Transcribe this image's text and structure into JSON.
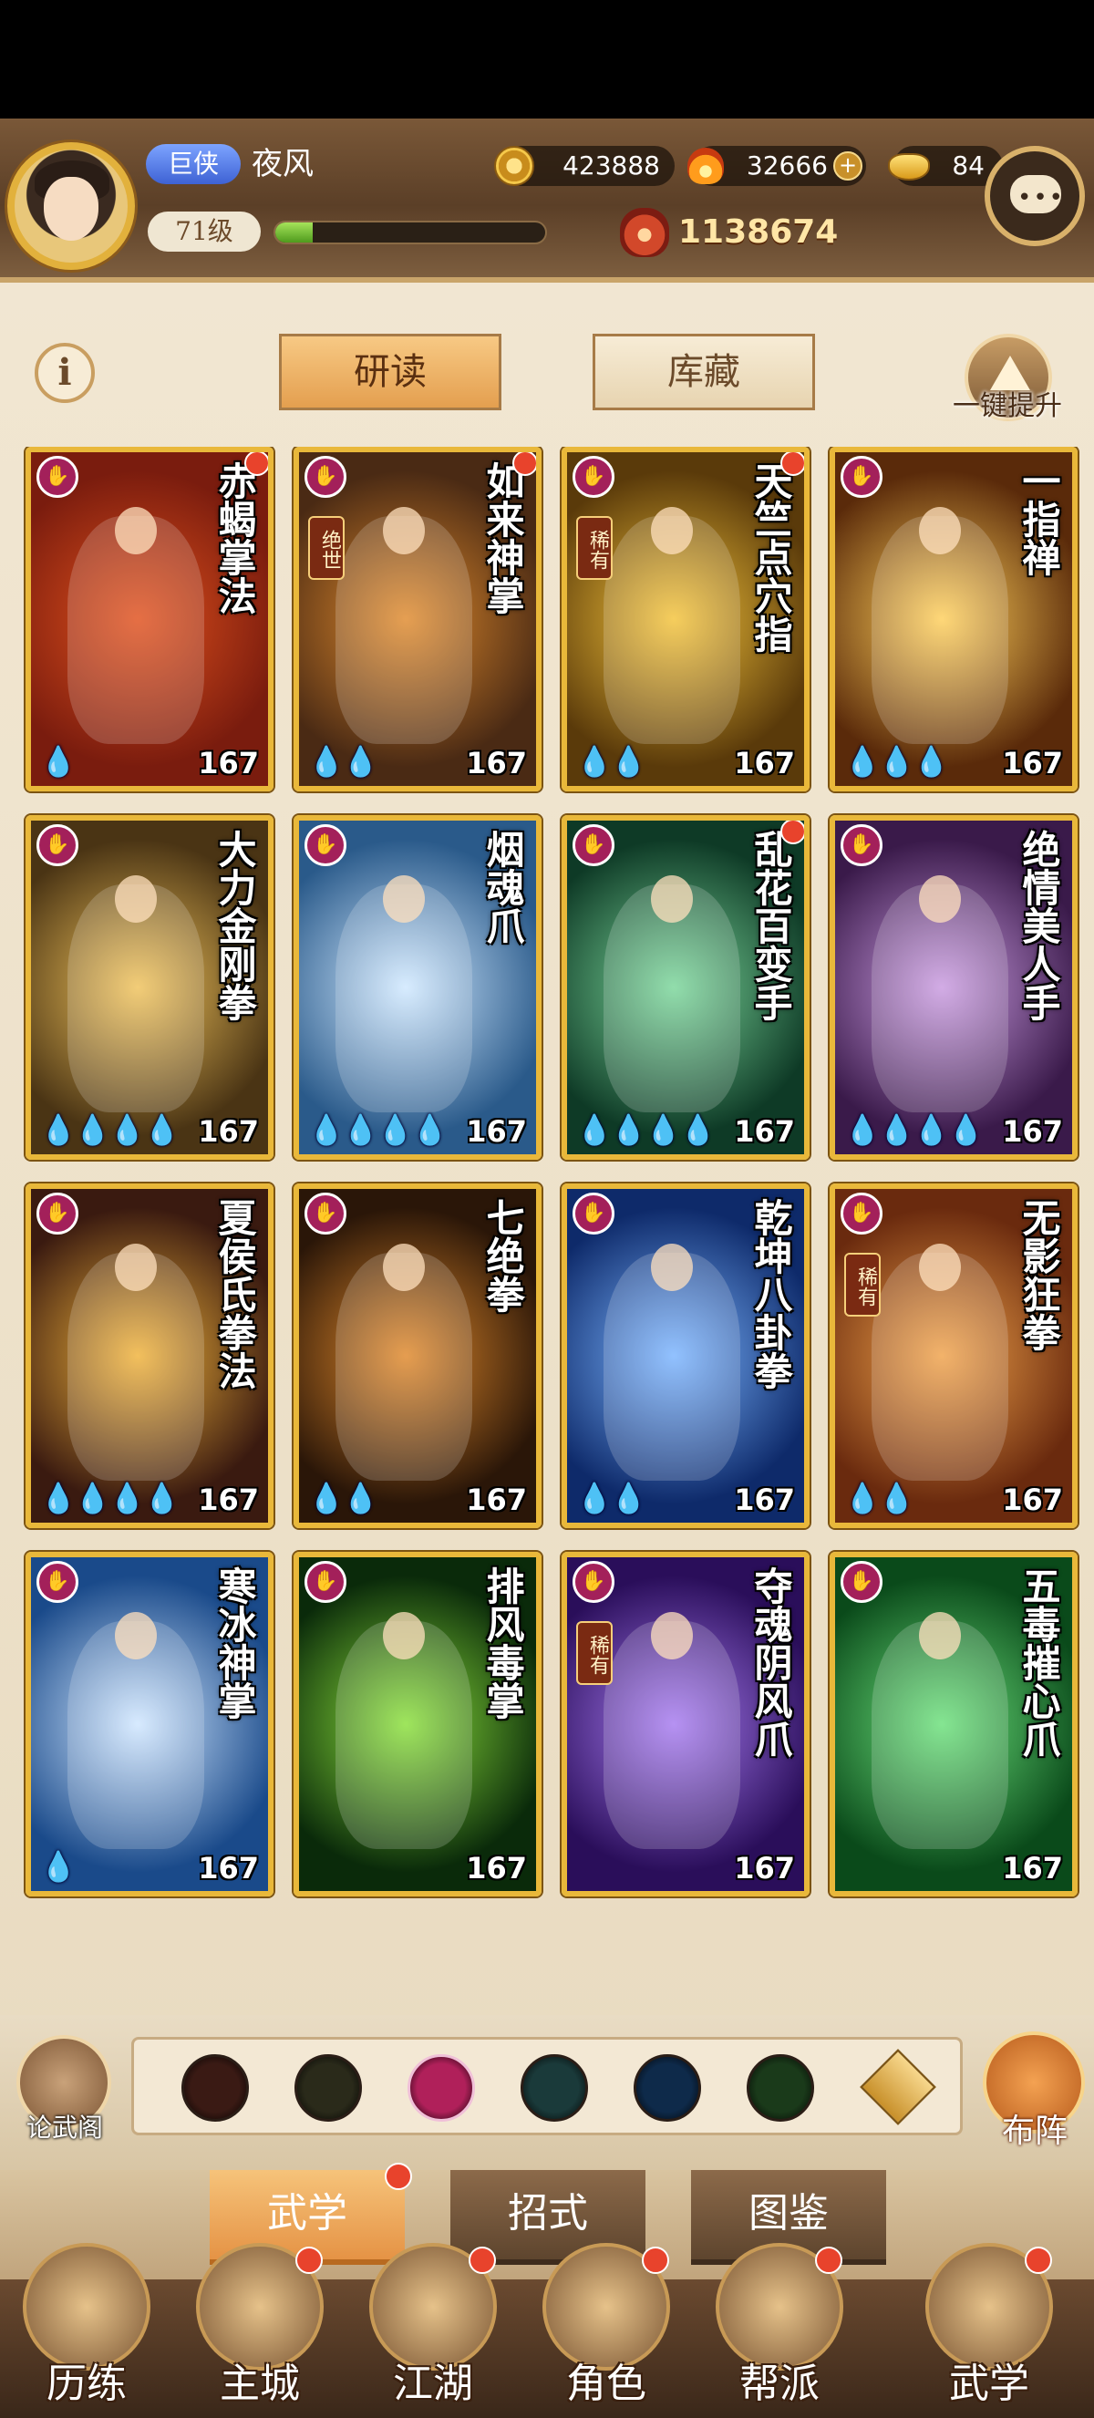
{
  "player": {
    "rank": "巨侠",
    "name": "夜风",
    "level": "71级",
    "exp_fraction": 0.14
  },
  "resources": {
    "coins": "423888",
    "spirit": "32666",
    "gold": "84",
    "plus": "+"
  },
  "power": "1138674",
  "subtabs": {
    "study": "研读",
    "collection": "库藏",
    "upgrade_all": "一键提升"
  },
  "cards": [
    {
      "name": "赤蝎掌法",
      "drops": "💧",
      "level": "167",
      "tag": "",
      "dot": true,
      "bg": "#7a1c0e",
      "bg2": "#e0501c"
    },
    {
      "name": "如来神掌",
      "drops": "💧💧",
      "level": "167",
      "tag": "绝世",
      "dot": true,
      "bg": "#4a2a14",
      "bg2": "#e08a2c"
    },
    {
      "name": "天竺点穴指",
      "drops": "💧💧",
      "level": "167",
      "tag": "稀有",
      "dot": true,
      "bg": "#5a3a0a",
      "bg2": "#f4c33a"
    },
    {
      "name": "一指禅",
      "drops": "💧💧💧",
      "level": "167",
      "tag": "",
      "dot": false,
      "bg": "#5a2a0a",
      "bg2": "#ffcf5a"
    },
    {
      "name": "大力金刚拳",
      "drops": "💧💧💧💧",
      "level": "167",
      "tag": "",
      "dot": false,
      "bg": "#4a3414",
      "bg2": "#f0c25a"
    },
    {
      "name": "烟魂爪",
      "drops": "💧💧💧💧",
      "level": "167",
      "tag": "",
      "dot": false,
      "bg": "#2a5a8a",
      "bg2": "#cfe8ff"
    },
    {
      "name": "乱花百变手",
      "drops": "💧💧💧💧",
      "level": "167",
      "tag": "",
      "dot": true,
      "bg": "#0e3a26",
      "bg2": "#7ad69a"
    },
    {
      "name": "绝情美人手",
      "drops": "💧💧💧💧",
      "level": "167",
      "tag": "",
      "dot": false,
      "bg": "#3a1a4a",
      "bg2": "#c99ae0"
    },
    {
      "name": "夏侯氏拳法",
      "drops": "💧💧💧💧",
      "level": "167",
      "tag": "",
      "dot": false,
      "bg": "#3a1a10",
      "bg2": "#f0b23a"
    },
    {
      "name": "七绝拳",
      "drops": "💧💧",
      "level": "167",
      "tag": "",
      "dot": false,
      "bg": "#2a1608",
      "bg2": "#e0882a"
    },
    {
      "name": "乾坤八卦拳",
      "drops": "💧💧",
      "level": "167",
      "tag": "",
      "dot": false,
      "bg": "#0e2a6a",
      "bg2": "#7ab4ff"
    },
    {
      "name": "无影狂拳",
      "drops": "💧💧",
      "level": "167",
      "tag": "稀有",
      "dot": false,
      "bg": "#6a2a0e",
      "bg2": "#f0a24a"
    },
    {
      "name": "寒冰神掌",
      "drops": "💧",
      "level": "167",
      "tag": "",
      "dot": false,
      "bg": "#1a4a8a",
      "bg2": "#cfe6ff"
    },
    {
      "name": "排风毒掌",
      "drops": "",
      "level": "167",
      "tag": "",
      "dot": false,
      "bg": "#0a2a0a",
      "bg2": "#8ae03a"
    },
    {
      "name": "夺魂阴风爪",
      "drops": "",
      "level": "167",
      "tag": "稀有",
      "dot": false,
      "bg": "#2a0e5a",
      "bg2": "#a67af0"
    },
    {
      "name": "五毒摧心爪",
      "drops": "",
      "level": "167",
      "tag": "",
      "dot": false,
      "bg": "#0a4a1a",
      "bg2": "#6ae07a"
    }
  ],
  "filter": {
    "lunwu_label": "论武阁",
    "buzhen_label": "布阵",
    "items": [
      {
        "icon": "sword-school-icon",
        "color": "#3a1a14"
      },
      {
        "icon": "blade-school-icon",
        "color": "#2a2a1a"
      },
      {
        "icon": "palm-school-icon",
        "color": "#b0205a"
      },
      {
        "icon": "leaf-school-icon",
        "color": "#1a3a3a"
      },
      {
        "icon": "spiral-school-icon",
        "color": "#0e2a4a"
      },
      {
        "icon": "ring-school-icon",
        "color": "#1a3a1a"
      }
    ]
  },
  "main_tabs": {
    "wuxue": "武学",
    "zhaoshi": "招式",
    "tujian": "图鉴"
  },
  "nav": [
    {
      "label": "历练",
      "dot": false
    },
    {
      "label": "主城",
      "dot": true
    },
    {
      "label": "江湖",
      "dot": true
    },
    {
      "label": "角色",
      "dot": true
    },
    {
      "label": "帮派",
      "dot": true
    },
    {
      "label": "武学",
      "dot": true
    }
  ],
  "colors": {
    "accent": "#e49f4f",
    "badge": "#e8432c",
    "card_border": "#e9b83a"
  }
}
